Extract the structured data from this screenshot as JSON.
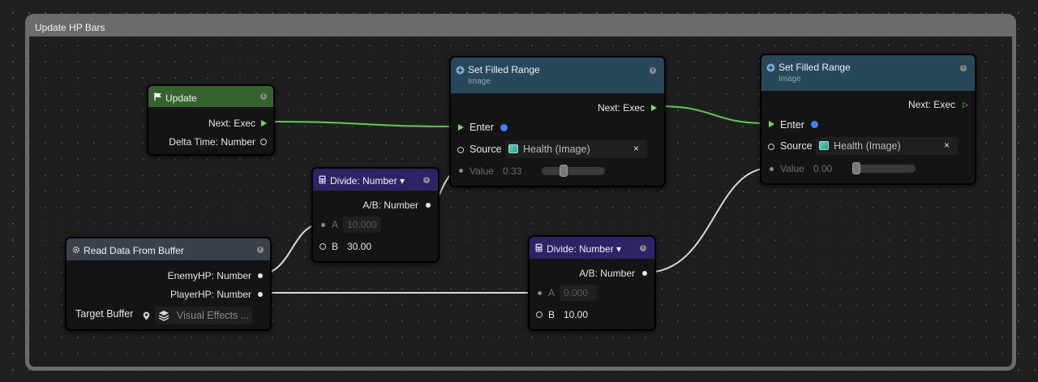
{
  "group": {
    "title": "Update HP Bars"
  },
  "colors": {
    "exec_wire": "#5ccf4a",
    "data_wire": "#d9d9d9",
    "event_head": "#35632e",
    "action_head": "#27475a",
    "math_head": "#2d2366",
    "buffer_head": "#39414a"
  },
  "nodes": {
    "update": {
      "title": "Update",
      "icon": "flag-icon",
      "next_exec": "Next: Exec",
      "delta_time": "Delta Time: Number"
    },
    "read_buffer": {
      "title": "Read Data From Buffer",
      "icon": "gear-icon",
      "enemy_hp": "EnemyHP: Number",
      "player_hp": "PlayerHP: Number",
      "target_label": "Target Buffer",
      "target_value": "Visual Effects ..."
    },
    "divide1": {
      "title": "Divide: Number ▾",
      "icon": "calculator-icon",
      "output": "A/B: Number",
      "a_label": "A",
      "a_value": "10.000",
      "b_label": "B",
      "b_value": "30.00"
    },
    "divide2": {
      "title": "Divide: Number ▾",
      "icon": "calculator-icon",
      "output": "A/B: Number",
      "a_label": "A",
      "a_value": "0.000",
      "b_label": "B",
      "b_value": "10.00"
    },
    "set_fill1": {
      "title": "Set Filled Range",
      "subtitle": "Image",
      "icon": "plus-circle-icon",
      "next_exec": "Next: Exec",
      "enter": "Enter",
      "source_label": "Source",
      "source_value": "Health (Image)",
      "clear": "×",
      "value_label": "Value",
      "value_number": "0.33",
      "slider_fraction": 0.33
    },
    "set_fill2": {
      "title": "Set Filled Range",
      "subtitle": "Image",
      "icon": "plus-circle-icon",
      "next_exec": "Next: Exec",
      "enter": "Enter",
      "source_label": "Source",
      "source_value": "Health (Image)",
      "clear": "×",
      "value_label": "Value",
      "value_number": "0.00",
      "slider_fraction": 0.0
    }
  }
}
